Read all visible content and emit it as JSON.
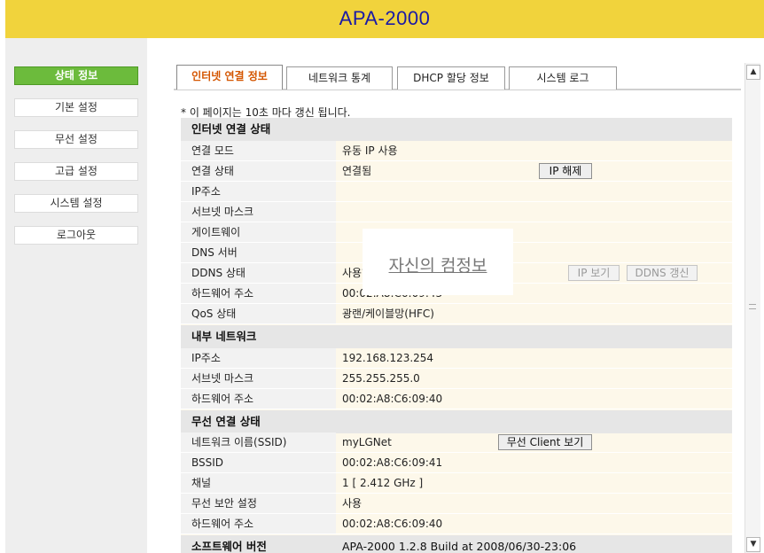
{
  "header": {
    "title": "APA-2000"
  },
  "sidebar": {
    "items": [
      {
        "label": "상태 정보"
      },
      {
        "label": "기본 설정"
      },
      {
        "label": "무선 설정"
      },
      {
        "label": "고급 설정"
      },
      {
        "label": "시스템 설정"
      },
      {
        "label": "로그아웃"
      }
    ]
  },
  "tabs": [
    {
      "label": "인터넷 연결 정보"
    },
    {
      "label": "네트워크 통계"
    },
    {
      "label": "DHCP 할당 정보"
    },
    {
      "label": "시스템 로그"
    }
  ],
  "note": "* 이 페이지는 10초 마다 갱신 됩니다.",
  "overlay_text": "자신의 컴정보",
  "internet": {
    "title": "인터넷 연결 상태",
    "rows": [
      {
        "label": "연결 모드",
        "value": "유동 IP 사용"
      },
      {
        "label": "연결 상태",
        "value": "연결됨"
      },
      {
        "label": "IP주소",
        "value": ""
      },
      {
        "label": "서브넷 마스크",
        "value": ""
      },
      {
        "label": "게이트웨이",
        "value": ""
      },
      {
        "label": "DNS 서버",
        "value": ""
      },
      {
        "label": "DDNS 상태",
        "value": "사용하지 않음"
      },
      {
        "label": "하드웨어 주소",
        "value": "00:02:A8:C6:09:43"
      },
      {
        "label": "QoS 상태",
        "value": "광랜/케이블망(HFC)"
      }
    ],
    "buttons": {
      "ip_release": "IP 해제",
      "ip_view": "IP 보기",
      "ddns_update": "DDNS 갱신"
    }
  },
  "internal": {
    "title": "내부 네트워크",
    "rows": [
      {
        "label": "IP주소",
        "value": "192.168.123.254"
      },
      {
        "label": "서브넷 마스크",
        "value": "255.255.255.0"
      },
      {
        "label": "하드웨어 주소",
        "value": "00:02:A8:C6:09:40"
      }
    ]
  },
  "wireless": {
    "title": "무선 연결 상태",
    "rows": [
      {
        "label": "네트워크 이름(SSID)",
        "value": "myLGNet"
      },
      {
        "label": "BSSID",
        "value": "00:02:A8:C6:09:41"
      },
      {
        "label": "채널",
        "value": "1 [ 2.412 GHz ]"
      },
      {
        "label": "무선 보안 설정",
        "value": "사용"
      },
      {
        "label": "하드웨어 주소",
        "value": "00:02:A8:C6:09:40"
      }
    ],
    "buttons": {
      "client_view": "무선 Client 보기"
    }
  },
  "software": {
    "label": "소프트웨어 버전",
    "value": "APA-2000 1.2.8 Build at 2008/06/30-23:06"
  },
  "scrollbar": {
    "up_icon": "▲",
    "down_icon": "▼"
  }
}
